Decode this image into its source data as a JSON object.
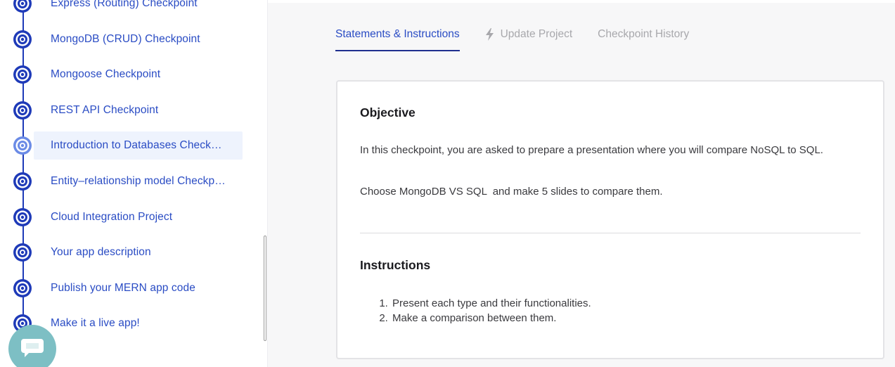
{
  "sidebar": {
    "items": [
      {
        "label": "Express (Routing) Checkpoint",
        "active": false
      },
      {
        "label": "MongoDB (CRUD) Checkpoint",
        "active": false
      },
      {
        "label": "Mongoose Checkpoint",
        "active": false
      },
      {
        "label": "REST API Checkpoint",
        "active": false
      },
      {
        "label": "Introduction to Databases Checkpoint",
        "active": true
      },
      {
        "label": "Entity–relationship model Checkpoint",
        "active": false
      },
      {
        "label": "Cloud Integration Project",
        "active": false
      },
      {
        "label": "Your app description",
        "active": false
      },
      {
        "label": "Publish your MERN app code",
        "active": false
      },
      {
        "label": "Make it a live app!",
        "active": false
      }
    ],
    "node_icon": "target-icon",
    "chat_icon": "chat-bubble-icon"
  },
  "tabs": [
    {
      "label": "Statements & Instructions",
      "active": true,
      "icon": ""
    },
    {
      "label": "Update Project",
      "active": false,
      "icon": "bolt-icon"
    },
    {
      "label": "Checkpoint History",
      "active": false,
      "icon": ""
    }
  ],
  "content": {
    "objective_title": "Objective",
    "objective_paragraph_1": "In this checkpoint, you are asked to prepare a presentation where you will compare NoSQL to SQL.",
    "objective_paragraph_2": "Choose MongoDB VS SQL  and make 5 slides to compare them.",
    "instructions_title": "Instructions",
    "instructions": [
      "Present each type and their functionalities.",
      "Make a comparison between them."
    ]
  },
  "colors": {
    "accent": "#2a4cc4",
    "timeline": "#1e3ab8",
    "active_bg": "#eef3fd",
    "chat": "#7dbfc4"
  }
}
